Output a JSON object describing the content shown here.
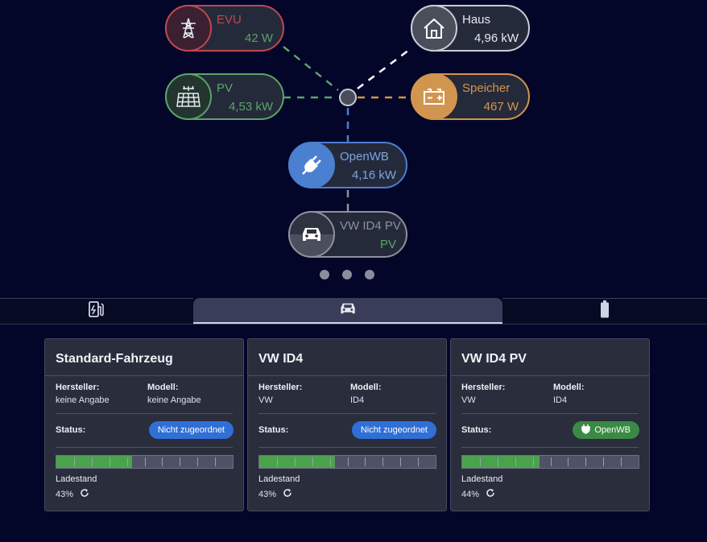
{
  "colors": {
    "background": "#030628",
    "grid": "#c0484e",
    "pv": "#5aa468",
    "house": "#c9cbd6",
    "storage": "#d2954f",
    "openwb": "#4b7fd0",
    "vehicle": "#8e909c",
    "green_value": "#5aa468",
    "badge_blue": "#2f6fd6",
    "badge_green": "#3a8a45"
  },
  "flow": {
    "evu": {
      "title": "EVU",
      "value": "42 W",
      "icon": "power-pylon-icon"
    },
    "pv": {
      "title": "PV",
      "value": "4,53 kW",
      "icon": "solar-panel-icon"
    },
    "haus": {
      "title": "Haus",
      "value": "4,96 kW",
      "icon": "house-icon"
    },
    "speicher": {
      "title": "Speicher",
      "value": "467 W",
      "icon": "battery-icon"
    },
    "openwb": {
      "title": "OpenWB",
      "value": "4,16 kW",
      "icon": "plug-icon"
    },
    "vehicle": {
      "title": "VW ID4 PV",
      "value": "PV",
      "icon": "car-icon"
    }
  },
  "pagination": {
    "count": 3
  },
  "tabs": [
    {
      "icon": "charge-station-icon",
      "active": false
    },
    {
      "icon": "car-icon",
      "active": true
    },
    {
      "icon": "battery-icon",
      "active": false
    }
  ],
  "cards": [
    {
      "title": "Standard-Fahrzeug",
      "hersteller_label": "Hersteller:",
      "hersteller": "keine Angabe",
      "modell_label": "Modell:",
      "modell": "keine Angabe",
      "status_label": "Status:",
      "status": "Nicht zugeordnet",
      "status_color": "#2f6fd6",
      "soc_label": "Ladestand",
      "soc": "43%",
      "soc_fraction": 0.43
    },
    {
      "title": "VW ID4",
      "hersteller_label": "Hersteller:",
      "hersteller": "VW",
      "modell_label": "Modell:",
      "modell": "ID4",
      "status_label": "Status:",
      "status": "Nicht zugeordnet",
      "status_color": "#2f6fd6",
      "soc_label": "Ladestand",
      "soc": "43%",
      "soc_fraction": 0.43
    },
    {
      "title": "VW ID4 PV",
      "hersteller_label": "Hersteller:",
      "hersteller": "VW",
      "modell_label": "Modell:",
      "modell": "ID4",
      "status_label": "Status:",
      "status": "OpenWB",
      "status_color": "#3a8a45",
      "soc_label": "Ladestand",
      "soc": "44%",
      "soc_fraction": 0.44
    }
  ]
}
